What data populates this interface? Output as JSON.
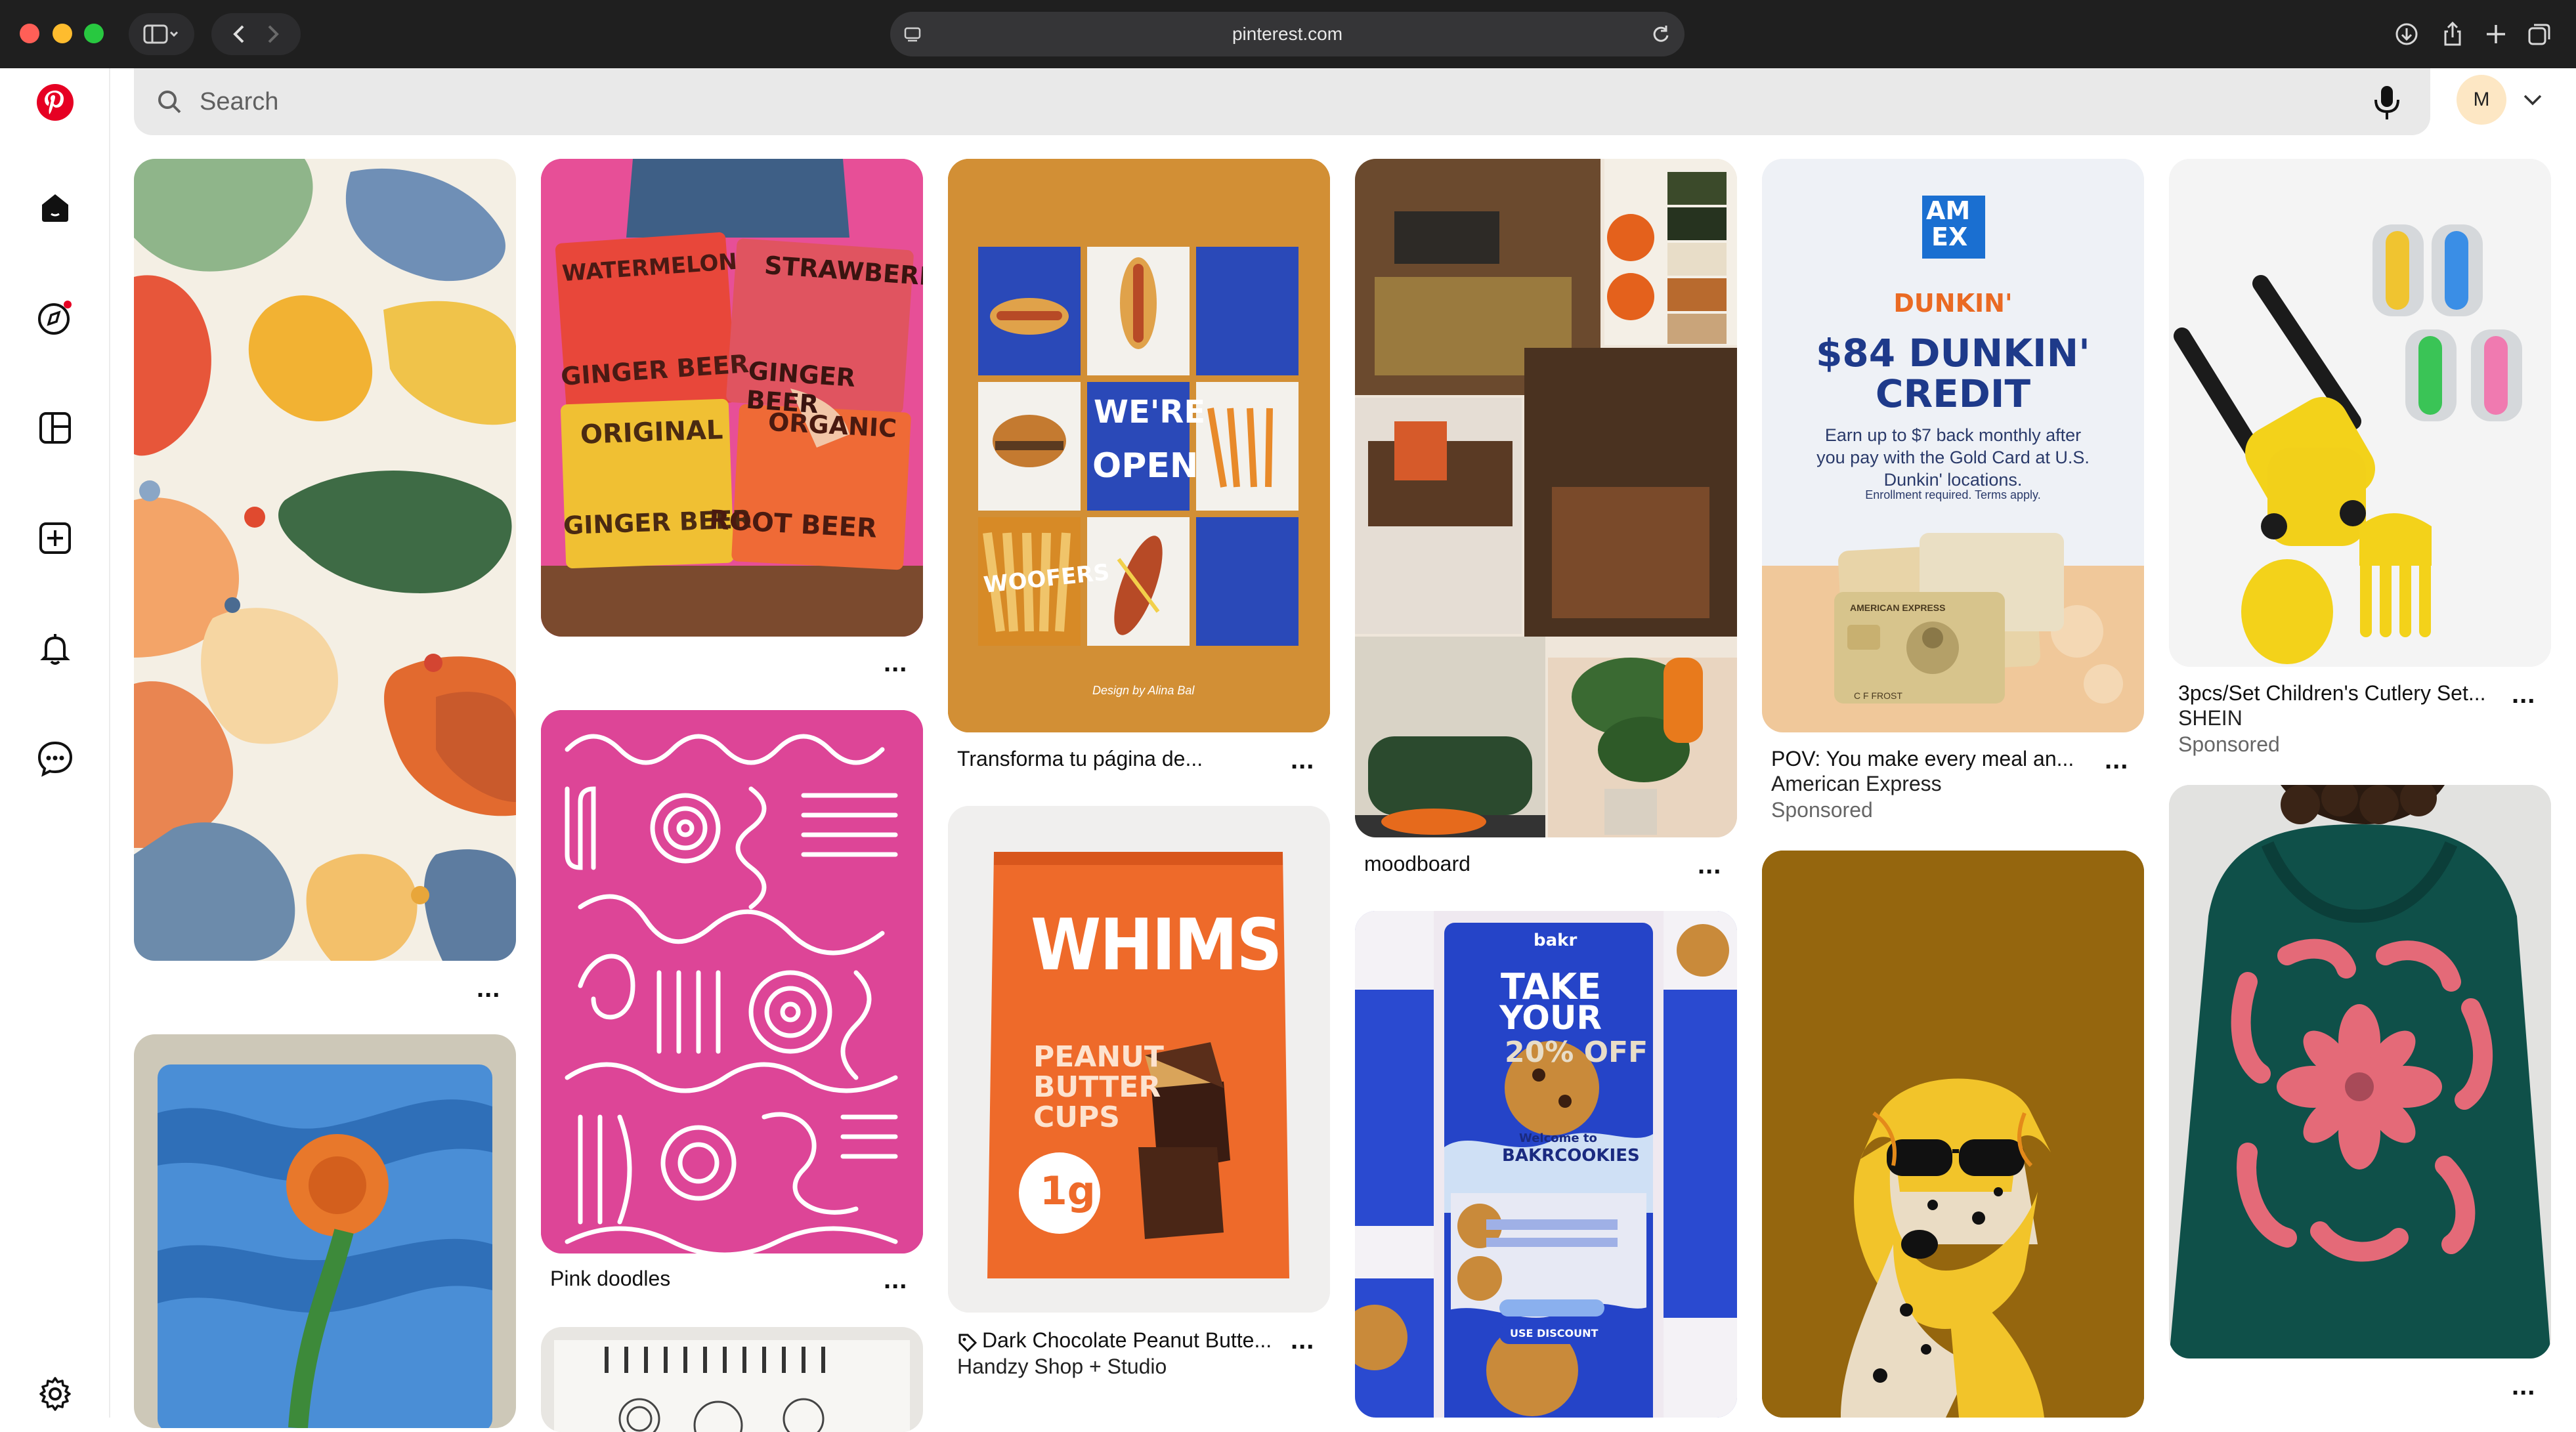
{
  "browser": {
    "url": "pinterest.com"
  },
  "search": {
    "placeholder": "Search"
  },
  "user": {
    "avatar_initial": "M"
  },
  "sidebar": {
    "items": [
      {
        "name": "home",
        "icon": "home-icon"
      },
      {
        "name": "explore",
        "icon": "compass-icon"
      },
      {
        "name": "boards",
        "icon": "boards-icon"
      },
      {
        "name": "create",
        "icon": "plus-square-icon"
      },
      {
        "name": "notifications",
        "icon": "bell-icon"
      },
      {
        "name": "messages",
        "icon": "chat-icon"
      },
      {
        "name": "settings",
        "icon": "gear-icon"
      }
    ]
  },
  "pins": {
    "col2_top": {
      "more": "..."
    },
    "col2_pink": {
      "title": "Pink doodles",
      "more": "..."
    },
    "col3_top": {
      "title": "Transforma tu página de...",
      "more": "..."
    },
    "col3_whims": {
      "title": "Dark Chocolate Peanut Butte...",
      "subtitle": "Handzy Shop + Studio",
      "more": "..."
    },
    "col4_mood": {
      "title": "moodboard",
      "more": "..."
    },
    "col5_amex": {
      "title": "POV: You make every meal an...",
      "subtitle": "American Express",
      "sponsored": "Sponsored",
      "more": "..."
    },
    "col6_cutlery": {
      "title": "3pcs/Set Children's Cutlery Set...",
      "subtitle": "SHEIN",
      "sponsored": "Sponsored",
      "more": "..."
    },
    "col1_blob": {
      "more": "..."
    }
  },
  "pin_images": {
    "beer": {
      "labels": [
        "WATERMELON",
        "GINGER BEER",
        "STRAWBERRY",
        "GINGER BEER",
        "ORIGINAL",
        "GINGER BEER",
        "ORGANIC",
        "ROOT BEER"
      ]
    },
    "hotdog": {
      "labels": [
        "WE'RE",
        "OPEN",
        "WOOFERS"
      ],
      "credit": "Design by Alina Bal"
    },
    "whims": {
      "brand": "WHIMS",
      "product": "PEANUT BUTTER CUPS",
      "badge": "1g"
    },
    "amex": {
      "logo_line1": "AM",
      "logo_line2": "EX",
      "brand": "DUNKIN'",
      "headline1": "$84 DUNKIN'",
      "headline2": "CREDIT",
      "body1": "Earn up to $7 back monthly after",
      "body2": "you pay with the Gold Card at U.S.",
      "body3": "Dunkin' locations.",
      "fine": "Enrollment required. Terms apply.",
      "card_name": "AMERICAN EXPRESS",
      "card_holder": "C F FROST"
    },
    "cookie": {
      "brand": "bakr",
      "headline1": "TAKE",
      "headline2": "YOUR",
      "headline3": "20% OFF",
      "welcome": "Welcome to",
      "name": "BAKRCOOKIES",
      "cta": "USE DISCOUNT"
    }
  },
  "colors": {
    "pinterest_red": "#e60023",
    "chrome_bg": "#1f1f1f",
    "search_bg": "#e9e9e9"
  }
}
